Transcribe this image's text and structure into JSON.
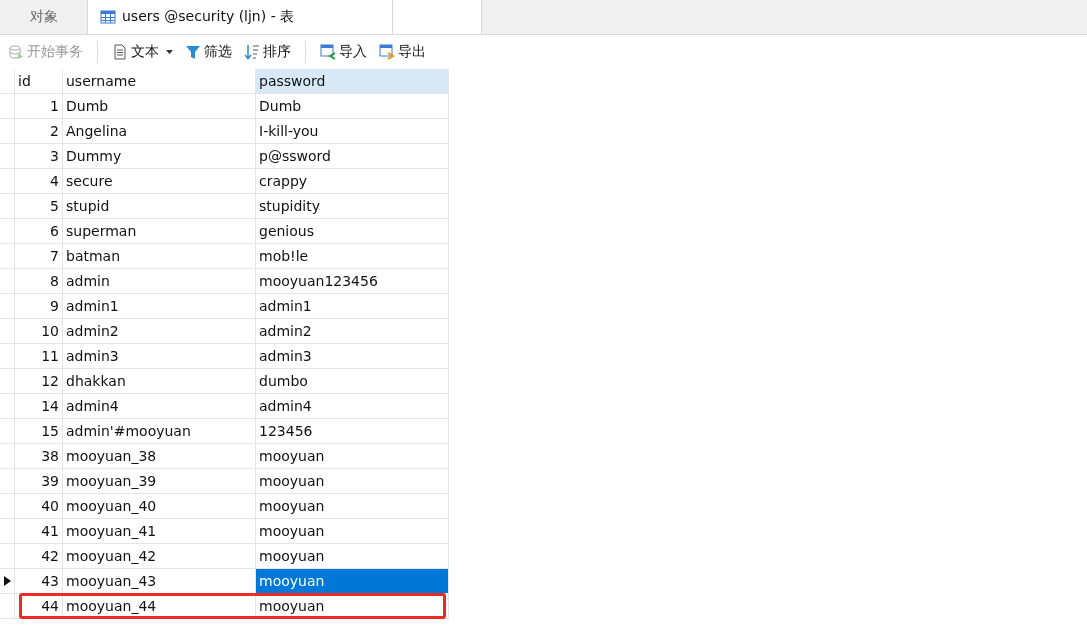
{
  "tabs": [
    {
      "label": "对象",
      "selected": false,
      "kind": "plain"
    },
    {
      "label": "users @security (ljn) - 表",
      "selected": true,
      "kind": "table"
    }
  ],
  "toolbar": [
    {
      "label": "开始事务",
      "kind": "transaction",
      "disabled": true
    },
    {
      "label": "文本",
      "kind": "text",
      "disabled": false
    },
    {
      "label": "筛选",
      "kind": "filter",
      "disabled": false
    },
    {
      "label": "排序",
      "kind": "sort",
      "disabled": false
    },
    {
      "label": "导入",
      "kind": "import",
      "disabled": false
    },
    {
      "label": "导出",
      "kind": "export",
      "disabled": false
    }
  ],
  "table": {
    "columns": [
      "id",
      "username",
      "password"
    ],
    "rows": [
      {
        "id": "1",
        "username": "Dumb",
        "password": "Dumb",
        "current": false,
        "selected": false,
        "highlighted": false
      },
      {
        "id": "2",
        "username": "Angelina",
        "password": "I-kill-you",
        "current": false,
        "selected": false,
        "highlighted": false
      },
      {
        "id": "3",
        "username": "Dummy",
        "password": "p@ssword",
        "current": false,
        "selected": false,
        "highlighted": false
      },
      {
        "id": "4",
        "username": "secure",
        "password": "crappy",
        "current": false,
        "selected": false,
        "highlighted": false
      },
      {
        "id": "5",
        "username": "stupid",
        "password": "stupidity",
        "current": false,
        "selected": false,
        "highlighted": false
      },
      {
        "id": "6",
        "username": "superman",
        "password": "genious",
        "current": false,
        "selected": false,
        "highlighted": false
      },
      {
        "id": "7",
        "username": "batman",
        "password": "mob!le",
        "current": false,
        "selected": false,
        "highlighted": false
      },
      {
        "id": "8",
        "username": "admin",
        "password": "mooyuan123456",
        "current": false,
        "selected": false,
        "highlighted": false
      },
      {
        "id": "9",
        "username": "admin1",
        "password": "admin1",
        "current": false,
        "selected": false,
        "highlighted": false
      },
      {
        "id": "10",
        "username": "admin2",
        "password": "admin2",
        "current": false,
        "selected": false,
        "highlighted": false
      },
      {
        "id": "11",
        "username": "admin3",
        "password": "admin3",
        "current": false,
        "selected": false,
        "highlighted": false
      },
      {
        "id": "12",
        "username": "dhakkan",
        "password": "dumbo",
        "current": false,
        "selected": false,
        "highlighted": false
      },
      {
        "id": "14",
        "username": "admin4",
        "password": "admin4",
        "current": false,
        "selected": false,
        "highlighted": false
      },
      {
        "id": "15",
        "username": "admin'#mooyuan",
        "password": "123456",
        "current": false,
        "selected": false,
        "highlighted": false
      },
      {
        "id": "38",
        "username": "mooyuan_38",
        "password": "mooyuan",
        "current": false,
        "selected": false,
        "highlighted": false
      },
      {
        "id": "39",
        "username": "mooyuan_39",
        "password": "mooyuan",
        "current": false,
        "selected": false,
        "highlighted": false
      },
      {
        "id": "40",
        "username": "mooyuan_40",
        "password": "mooyuan",
        "current": false,
        "selected": false,
        "highlighted": false
      },
      {
        "id": "41",
        "username": "mooyuan_41",
        "password": "mooyuan",
        "current": false,
        "selected": false,
        "highlighted": false
      },
      {
        "id": "42",
        "username": "mooyuan_42",
        "password": "mooyuan",
        "current": false,
        "selected": false,
        "highlighted": false
      },
      {
        "id": "43",
        "username": "mooyuan_43",
        "password": "mooyuan",
        "current": true,
        "selected": true,
        "highlighted": false
      },
      {
        "id": "44",
        "username": "mooyuan_44",
        "password": "mooyuan",
        "current": false,
        "selected": false,
        "highlighted": true
      }
    ]
  }
}
